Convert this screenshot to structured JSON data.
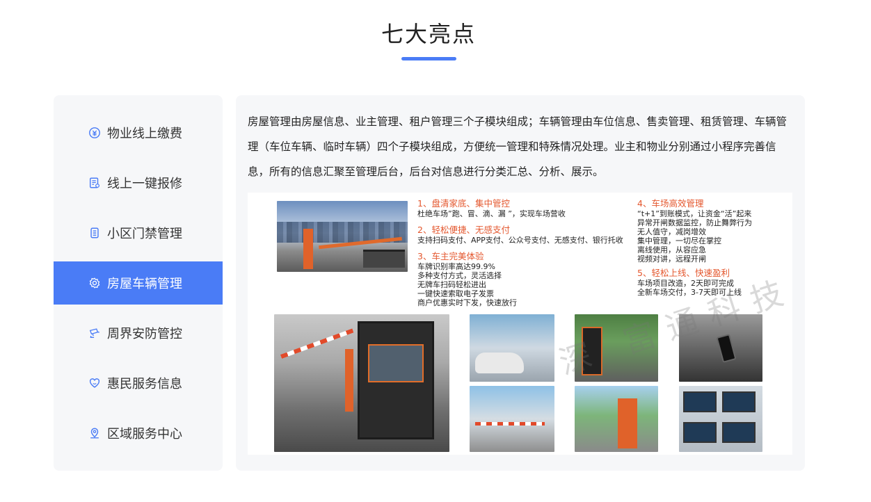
{
  "header": {
    "title": "七大亮点",
    "accent_color": "#4a7cf6"
  },
  "sidebar": {
    "active_index": 3,
    "items": [
      {
        "label": "物业线上缴费",
        "icon": "payment-icon"
      },
      {
        "label": "线上一键报修",
        "icon": "repair-form-icon"
      },
      {
        "label": "小区门禁管理",
        "icon": "access-card-icon"
      },
      {
        "label": "房屋车辆管理",
        "icon": "gear-icon"
      },
      {
        "label": "周界安防管控",
        "icon": "security-camera-icon"
      },
      {
        "label": "惠民服务信息",
        "icon": "heart-icon"
      },
      {
        "label": "区域服务中心",
        "icon": "location-pin-icon"
      }
    ]
  },
  "content": {
    "description": "房屋管理由房屋信息、业主管理、租户管理三个子模块组成；车辆管理由车位信息、售卖管理、租赁管理、车辆管理（车位车辆、临时车辆）四个子模块组成，方便统一管理和特殊情况处理。业主和物业分别通过小程序完善信息，所有的信息汇聚至管理后台，后台对信息进行分类汇总、分析、展示。",
    "figure": {
      "points": [
        {
          "title": "1、盘清家底、集中管控",
          "lines": [
            "杜绝车场”跑、冒、滴、漏 ”，实现车场营收"
          ]
        },
        {
          "title": "2、轻松便捷、无感支付",
          "lines": [
            "支持扫码支付、APP支付、公众号支付、无感支付、银行托收"
          ]
        },
        {
          "title": "3、车主完美体验",
          "lines": [
            "车牌识别率高达99.9%",
            "多种支付方式，灵活选择",
            "无牌车扫码轻松进出",
            "一键快速索取电子发票",
            "商户优惠实时下发，快速放行"
          ]
        },
        {
          "title": "4、车场高效管理",
          "lines": [
            "“t+1”到账模式，让资金“活”起来",
            "异常开闸数据监控，防止舞弊行为",
            "无人值守，减岗增效",
            "集中管理，一切尽在掌控",
            "离线使用，从容应急",
            "视频对讲，远程开闸"
          ]
        },
        {
          "title": "5、轻松上线、快速盈利",
          "lines": [
            "车场项目改造，2天即可完成",
            "全新车场交付，3-7天即可上线"
          ]
        }
      ],
      "watermark": "深  富通科技"
    }
  }
}
